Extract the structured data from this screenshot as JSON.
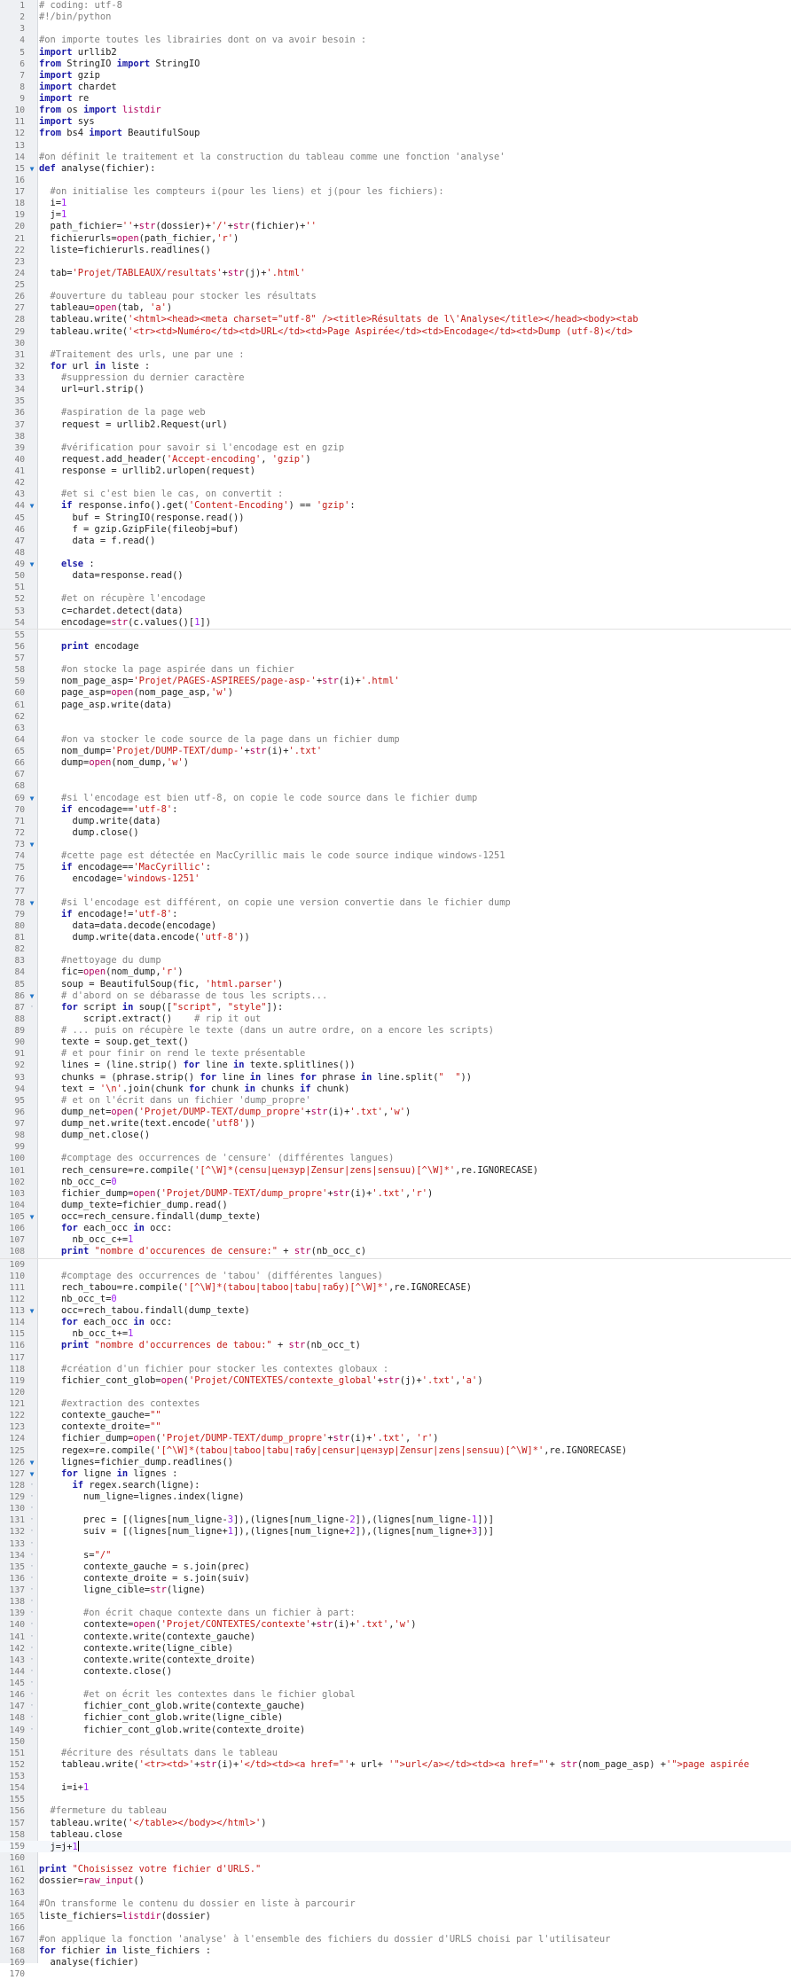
{
  "editor": {
    "language": "python",
    "current_line": 159,
    "colors": {
      "keyword": "#1a1aa6",
      "string": "#c41a16",
      "comment": "#808080",
      "number": "#a020f0",
      "builtin": "#b1005f",
      "line_number": "#7a7a7a",
      "fold_marker": "#1e73c8",
      "gutter_background": "#eef0f3"
    },
    "fold_markers": {
      "15": "open",
      "44": "open",
      "49": "open",
      "69": "open",
      "73": "open",
      "78": "open",
      "86": "open",
      "105": "open",
      "113": "open",
      "126": "open",
      "127": "open",
      "87": "dot",
      "128": "dot",
      "129": "dot",
      "130": "dot",
      "131": "dot",
      "132": "dot",
      "133": "dot",
      "134": "dot",
      "135": "dot",
      "136": "dot",
      "137": "dot",
      "138": "dot",
      "139": "dot",
      "140": "dot",
      "141": "dot",
      "142": "dot",
      "143": "dot",
      "144": "dot",
      "145": "dot",
      "146": "dot",
      "147": "dot",
      "148": "dot",
      "149": "dot"
    },
    "lines": [
      "# coding: utf-8",
      "#!/bin/python",
      "",
      "#on importe toutes les librairies dont on va avoir besoin :",
      "import urllib2",
      "from StringIO import StringIO",
      "import gzip",
      "import chardet",
      "import re",
      "from os import listdir",
      "import sys",
      "from bs4 import BeautifulSoup",
      "",
      "#on définit le traitement et la construction du tableau comme une fonction 'analyse'",
      "def analyse(fichier):",
      "",
      "  #on initialise les compteurs i(pour les liens) et j(pour les fichiers):",
      "  i=1",
      "  j=1",
      "  path_fichier=''+str(dossier)+'/'+str(fichier)+''",
      "  fichierurls=open(path_fichier,'r')",
      "  liste=fichierurls.readlines()",
      "",
      "  tab='Projet/TABLEAUX/resultats'+str(j)+'.html'",
      "",
      "  #ouverture du tableau pour stocker les résultats",
      "  tableau=open(tab, 'a')",
      "  tableau.write('<html><head><meta charset=\"utf-8\" /><title>Résultats de l\\'Analyse</title></head><body><tab",
      "  tableau.write('<tr><td>Numéro</td><td>URL</td><td>Page Aspirée</td><td>Encodage</td><td>Dump (utf-8)</td>",
      "",
      "  #Traitement des urls, une par une :",
      "  for url in liste :",
      "    #suppression du dernier caractère",
      "    url=url.strip()",
      "",
      "    #aspiration de la page web",
      "    request = urllib2.Request(url)",
      "",
      "    #vérification pour savoir si l'encodage est en gzip",
      "    request.add_header('Accept-encoding', 'gzip')",
      "    response = urllib2.urlopen(request)",
      "",
      "    #et si c'est bien le cas, on convertit :",
      "    if response.info().get('Content-Encoding') == 'gzip':",
      "      buf = StringIO(response.read())",
      "      f = gzip.GzipFile(fileobj=buf)",
      "      data = f.read()",
      "",
      "    else :",
      "      data=response.read()",
      "",
      "    #et on récupère l'encodage",
      "    c=chardet.detect(data)",
      "    encodage=str(c.values()[1])",
      "",
      "    print encodage",
      "",
      "    #on stocke la page aspirée dans un fichier",
      "    nom_page_asp='Projet/PAGES-ASPIREES/page-asp-'+str(i)+'.html'",
      "    page_asp=open(nom_page_asp,'w')",
      "    page_asp.write(data)",
      "",
      "",
      "    #on va stocker le code source de la page dans un fichier dump",
      "    nom_dump='Projet/DUMP-TEXT/dump-'+str(i)+'.txt'",
      "    dump=open(nom_dump,'w')",
      "",
      "",
      "    #si l'encodage est bien utf-8, on copie le code source dans le fichier dump",
      "    if encodage=='utf-8':",
      "      dump.write(data)",
      "      dump.close()",
      "",
      "    #cette page est détectée en MacCyrillic mais le code source indique windows-1251",
      "    if encodage=='MacCyrillic':",
      "      encodage='windows-1251'",
      "",
      "    #si l'encodage est différent, on copie une version convertie dans le fichier dump",
      "    if encodage!='utf-8':",
      "      data=data.decode(encodage)",
      "      dump.write(data.encode('utf-8'))",
      "",
      "    #nettoyage du dump",
      "    fic=open(nom_dump,'r')",
      "    soup = BeautifulSoup(fic, 'html.parser')",
      "    # d'abord on se débarasse de tous les scripts...",
      "    for script in soup([\"script\", \"style\"]):",
      "        script.extract()    # rip it out",
      "    # ... puis on récupère le texte (dans un autre ordre, on a encore les scripts)",
      "    texte = soup.get_text()",
      "    # et pour finir on rend le texte présentable",
      "    lines = (line.strip() for line in texte.splitlines())",
      "    chunks = (phrase.strip() for line in lines for phrase in line.split(\"  \"))",
      "    text = '\\n'.join(chunk for chunk in chunks if chunk)",
      "    # et on l'écrit dans un fichier 'dump_propre'",
      "    dump_net=open('Projet/DUMP-TEXT/dump_propre'+str(i)+'.txt','w')",
      "    dump_net.write(text.encode('utf8'))",
      "    dump_net.close()",
      "",
      "    #comptage des occurrences de 'censure' (différentes langues)",
      "    rech_censure=re.compile('[^\\W]*(censu|цензур|Zensur|zens|sensuu)[^\\W]*',re.IGNORECASE)",
      "    nb_occ_c=0",
      "    fichier_dump=open('Projet/DUMP-TEXT/dump_propre'+str(i)+'.txt','r')",
      "    dump_texte=fichier_dump.read()",
      "    occ=rech_censure.findall(dump_texte)",
      "    for each_occ in occ:",
      "      nb_occ_c+=1",
      "    print \"nombre d'occurences de censure:\" + str(nb_occ_c)",
      "",
      "    #comptage des occurrences de 'tabou' (différentes langues)",
      "    rech_tabou=re.compile('[^\\W]*(tabou|taboo|tabu|табу)[^\\W]*',re.IGNORECASE)",
      "    nb_occ_t=0",
      "    occ=rech_tabou.findall(dump_texte)",
      "    for each_occ in occ:",
      "      nb_occ_t+=1",
      "    print \"nombre d'occurrences de tabou:\" + str(nb_occ_t)",
      "",
      "    #création d'un fichier pour stocker les contextes globaux :",
      "    fichier_cont_glob=open('Projet/CONTEXTES/contexte_global'+str(j)+'.txt','a')",
      "",
      "    #extraction des contextes",
      "    contexte_gauche=\"\"",
      "    contexte_droite=\"\"",
      "    fichier_dump=open('Projet/DUMP-TEXT/dump_propre'+str(i)+'.txt', 'r')",
      "    regex=re.compile('[^\\W]*(tabou|taboo|tabu|табу|censur|цензур|Zensur|zens|sensuu)[^\\W]*',re.IGNORECASE)",
      "    lignes=fichier_dump.readlines()",
      "    for ligne in lignes :",
      "      if regex.search(ligne):",
      "        num_ligne=lignes.index(ligne)",
      "",
      "        prec = [(lignes[num_ligne-3]),(lignes[num_ligne-2]),(lignes[num_ligne-1])]",
      "        suiv = [(lignes[num_ligne+1]),(lignes[num_ligne+2]),(lignes[num_ligne+3])]",
      "",
      "        s=\"/\"",
      "        contexte_gauche = s.join(prec)",
      "        contexte_droite = s.join(suiv)",
      "        ligne_cible=str(ligne)",
      "",
      "        #on écrit chaque contexte dans un fichier à part:",
      "        contexte=open('Projet/CONTEXTES/contexte'+str(i)+'.txt','w')",
      "        contexte.write(contexte_gauche)",
      "        contexte.write(ligne_cible)",
      "        contexte.write(contexte_droite)",
      "        contexte.close()",
      "",
      "        #et on écrit les contextes dans le fichier global",
      "        fichier_cont_glob.write(contexte_gauche)",
      "        fichier_cont_glob.write(ligne_cible)",
      "        fichier_cont_glob.write(contexte_droite)",
      "",
      "    #écriture des résultats dans le tableau",
      "    tableau.write('<tr><td>'+str(i)+'</td><td><a href=\"'+ url+ '\">url</a></td><td><a href=\"'+ str(nom_page_asp) +'\">page aspirée",
      "",
      "    i=i+1",
      "",
      "  #fermeture du tableau",
      "  tableau.write('</table></body></html>')",
      "  tableau.close",
      "  j=j+1",
      "  ",
      "print \"Choisissez votre fichier d'URLS.\"",
      "dossier=raw_input()",
      "",
      "#On transforme le contenu du dossier en liste à parcourir",
      "liste_fichiers=listdir(dossier)",
      "",
      "#on applique la fonction 'analyse' à l'ensemble des fichiers du dossier d'URLS choisi par l'utilisateur",
      "for fichier in liste_fichiers :",
      "  analyse(fichier)",
      ""
    ]
  }
}
